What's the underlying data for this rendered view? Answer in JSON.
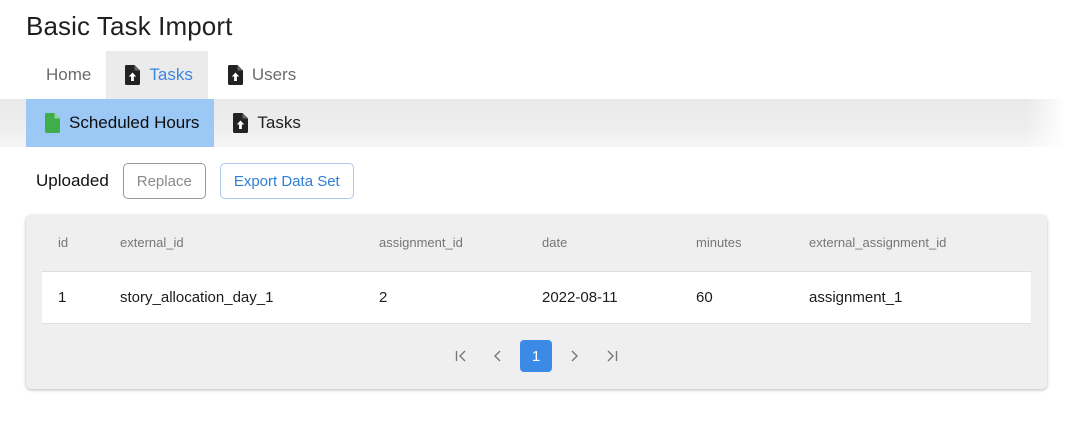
{
  "page": {
    "title": "Basic Task Import"
  },
  "top_tabs": [
    {
      "label": "Home",
      "icon": "",
      "active": false
    },
    {
      "label": "Tasks",
      "icon": "file-upload-icon",
      "active": true
    },
    {
      "label": "Users",
      "icon": "file-upload-icon",
      "active": false
    }
  ],
  "sub_tabs": [
    {
      "label": "Scheduled Hours",
      "icon": "file-icon",
      "active": true
    },
    {
      "label": "Tasks",
      "icon": "file-upload-icon",
      "active": false
    }
  ],
  "status": {
    "label": "Uploaded",
    "replace_label": "Replace",
    "export_label": "Export Data Set"
  },
  "table": {
    "columns": [
      "id",
      "external_id",
      "assignment_id",
      "date",
      "minutes",
      "external_assignment_id"
    ],
    "rows": [
      [
        "1",
        "story_allocation_day_1",
        "2",
        "2022-08-11",
        "60",
        "assignment_1"
      ]
    ]
  },
  "pagination": {
    "current_page": "1"
  },
  "colors": {
    "accent": "#3b8ae6",
    "active_top_tab_bg": "#ebebeb",
    "active_sub_tab_bg": "#9cc8f5",
    "file_icon_green": "#3fae49",
    "icon_dark": "#222222"
  }
}
